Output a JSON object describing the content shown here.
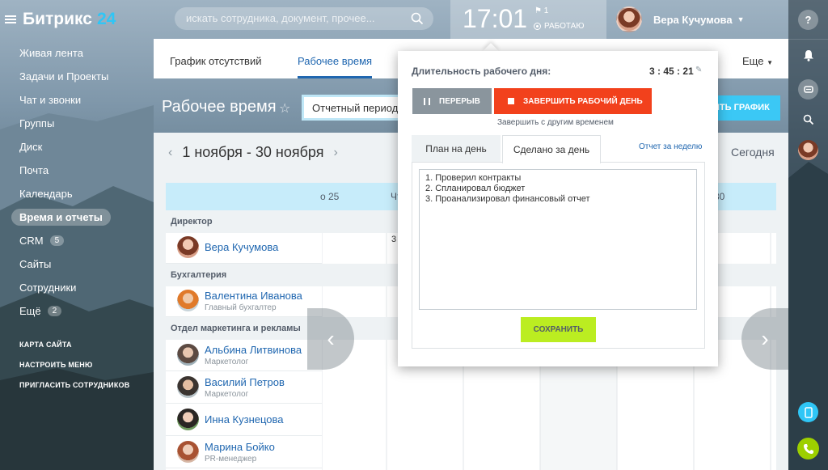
{
  "header": {
    "logo_name": "Битрикс",
    "logo_num": "24",
    "search_placeholder": "искать сотрудника, документ, прочее...",
    "clock": {
      "time": "17:01",
      "flag_count": "1",
      "status": "РАБОТАЮ"
    },
    "user_name": "Вера Кучумова"
  },
  "sidebar": {
    "items": [
      {
        "label": "Живая лента"
      },
      {
        "label": "Задачи и Проекты"
      },
      {
        "label": "Чат и звонки"
      },
      {
        "label": "Группы"
      },
      {
        "label": "Диск"
      },
      {
        "label": "Почта"
      },
      {
        "label": "Календарь"
      },
      {
        "label": "Время и отчеты"
      },
      {
        "label": "CRM",
        "counter": "5"
      },
      {
        "label": "Сайты"
      },
      {
        "label": "Сотрудники"
      },
      {
        "label": "Ещё",
        "counter": "2"
      }
    ],
    "links": [
      "КАРТА САЙТА",
      "НАСТРОИТЬ МЕНЮ",
      "ПРИГЛАСИТЬ СОТРУДНИКОВ"
    ]
  },
  "tabs": {
    "absence": "График отсутствий",
    "worktime": "Рабочее время",
    "more": "Еще"
  },
  "page": {
    "title": "Рабочее время",
    "period_label": "Отчетный период п",
    "schedule_button": "ИТЬ ГРАФИК",
    "range": "1 ноября - 30 ноября",
    "today": "Сегодня"
  },
  "grid": {
    "head_cells": [
      "о 25",
      "Чт",
      "30"
    ],
    "cell_value": "3",
    "groups": [
      {
        "name": "Директор",
        "people": [
          {
            "name": "Вера Кучумова",
            "role": ""
          }
        ]
      },
      {
        "name": "Бухгалтерия",
        "people": [
          {
            "name": "Валентина Иванова",
            "role": "Главный бухгалтер"
          }
        ]
      },
      {
        "name": "Отдел маркетинга и рекламы",
        "people": [
          {
            "name": "Альбина Литвинова",
            "role": "Маркетолог"
          },
          {
            "name": "Василий Петров",
            "role": "Маркетолог"
          },
          {
            "name": "Инна Кузнецова",
            "role": ""
          },
          {
            "name": "Марина Бойко",
            "role": "PR-менеджер"
          }
        ]
      }
    ]
  },
  "popup": {
    "duration_label": "Длительность рабочего дня:",
    "duration_value": "3 : 45 : 21",
    "pause_button": "ПЕРЕРЫВ",
    "finish_button": "ЗАВЕРШИТЬ РАБОЧИЙ ДЕНЬ",
    "finish_other_time": "Завершить с другим временем",
    "tab_plan": "План на день",
    "tab_done": "Сделано за день",
    "week_report": "Отчет за неделю",
    "report_lines": [
      "1. Проверил контракты",
      "2. Спланировал бюджет",
      "3. Проанализировал финансовый отчет"
    ],
    "save_button": "СОХРАНИТЬ"
  },
  "colors": {
    "accent": "#2067b0",
    "finish": "#f2411c",
    "save": "#bbed21",
    "schedule": "#3bc8f5"
  }
}
